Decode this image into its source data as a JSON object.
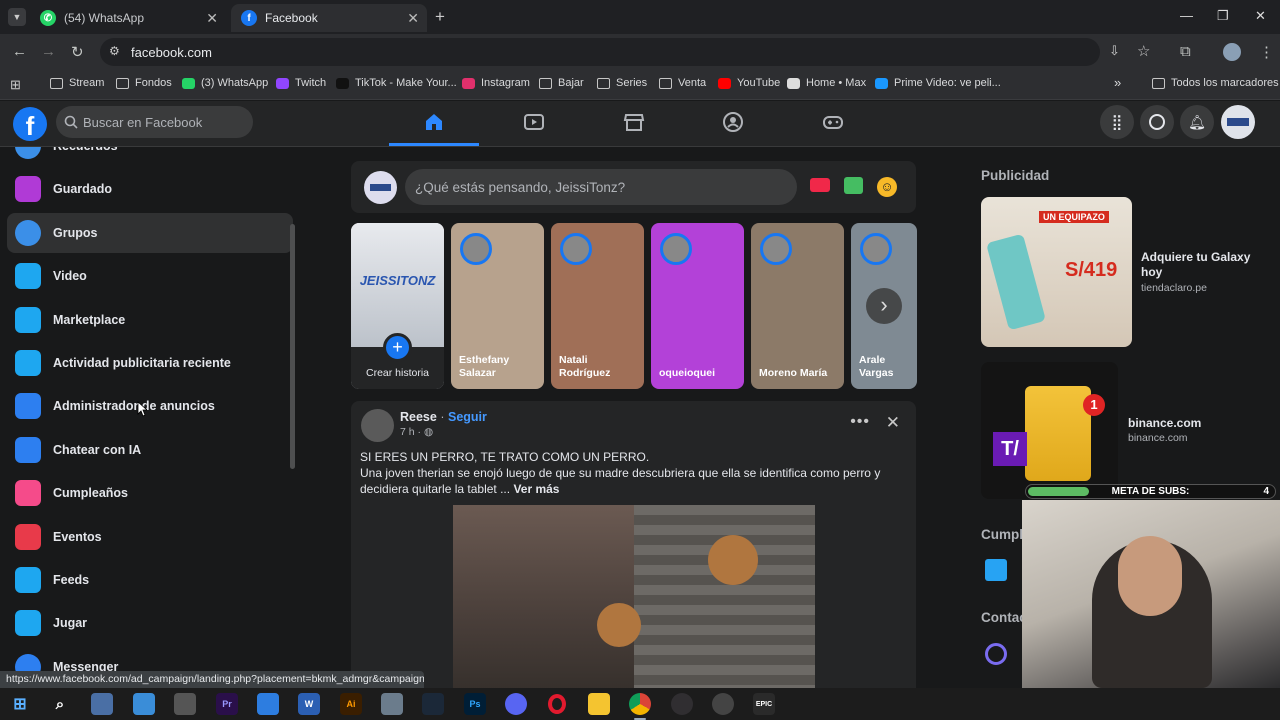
{
  "browser": {
    "tabs": [
      {
        "title": "(54) WhatsApp",
        "active": false
      },
      {
        "title": "Facebook",
        "active": true
      }
    ],
    "new_tab": "+",
    "url": "facebook.com",
    "bookmarks": [
      {
        "label": "Stream",
        "icon": "folder-icon"
      },
      {
        "label": "Fondos",
        "icon": "folder-icon"
      },
      {
        "label": "(3) WhatsApp",
        "icon": "whatsapp-icon"
      },
      {
        "label": "Twitch",
        "icon": "twitch-icon"
      },
      {
        "label": "TikTok - Make Your...",
        "icon": "tiktok-icon"
      },
      {
        "label": "Instagram",
        "icon": "instagram-icon"
      },
      {
        "label": "Bajar",
        "icon": "folder-icon"
      },
      {
        "label": "Series",
        "icon": "folder-icon"
      },
      {
        "label": "Venta",
        "icon": "folder-icon"
      },
      {
        "label": "YouTube",
        "icon": "youtube-icon"
      },
      {
        "label": "Home • Max",
        "icon": "max-icon"
      },
      {
        "label": "Prime Video: ve peli...",
        "icon": "prime-video-icon"
      }
    ],
    "overflow": "»",
    "all_bookmarks": "Todos los marcadores",
    "status_url": "https://www.facebook.com/ad_campaign/landing.php?placement=bkmk_admgr&campaign_i..."
  },
  "fb": {
    "search_placeholder": "Buscar en Facebook",
    "sidebar": [
      {
        "label": "Recuerdos",
        "icon": "memories-icon",
        "color": "#3b8fe8"
      },
      {
        "label": "Guardado",
        "icon": "saved-icon",
        "color": "#b03ad6"
      },
      {
        "label": "Grupos",
        "icon": "groups-icon",
        "color": "#3b8fe8"
      },
      {
        "label": "Video",
        "icon": "video-icon",
        "color": "#1ea7f0"
      },
      {
        "label": "Marketplace",
        "icon": "marketplace-icon",
        "color": "#1ea7f0"
      },
      {
        "label": "Actividad publicitaria reciente",
        "icon": "ad-activity-icon",
        "color": "#1ea7f0"
      },
      {
        "label": "Administrador de anuncios",
        "icon": "ads-manager-icon",
        "color": "#2d7ff0"
      },
      {
        "label": "Chatear con IA",
        "icon": "ai-chat-icon",
        "color": "#2d7ff0"
      },
      {
        "label": "Cumpleaños",
        "icon": "birthday-icon",
        "color": "#f54b8a"
      },
      {
        "label": "Eventos",
        "icon": "events-icon",
        "color": "#e83a4a"
      },
      {
        "label": "Feeds",
        "icon": "feeds-icon",
        "color": "#1ea7f0"
      },
      {
        "label": "Jugar",
        "icon": "play-icon",
        "color": "#1ea7f0"
      },
      {
        "label": "Messenger",
        "icon": "messenger-icon",
        "color": "#2d7ff0"
      }
    ],
    "composer_placeholder": "¿Qué estás pensando, JeissiTonz?",
    "stories": [
      {
        "name": "Crear historia",
        "own": true,
        "bg": "#cfd3d9"
      },
      {
        "name": "Esthefany Salazar",
        "bg": "#b7a28d"
      },
      {
        "name": "Natali Rodríguez",
        "bg": "#a06f57"
      },
      {
        "name": "oqueioquei",
        "bg": "#b341d8"
      },
      {
        "name": "Moreno María",
        "bg": "#8c7a68"
      },
      {
        "name": "Arale Vargas",
        "bg": "#7f8a93"
      }
    ],
    "story_logo": "JEISSITONZ",
    "post": {
      "author": "Reese",
      "follow": "Seguir",
      "time": "7 h",
      "separator": "·",
      "headline": "SI ERES UN PERRO, TE TRATO COMO UN PERRO.",
      "body": "Una joven therian se enojó luego de que su madre descubriera que ella se identifica como perro y decidiera quitarle la tablet ...",
      "more": "Ver más"
    },
    "right": {
      "ads_title": "Publicidad",
      "ads": [
        {
          "title": "Adquiere tu Galaxy hoy",
          "domain": "tiendaclaro.pe",
          "price": "S/419",
          "badge": "UN EQUIPAZO"
        },
        {
          "title": "binance.com",
          "domain": "binance.com",
          "badge": "1"
        }
      ],
      "birthdays_title": "Cumple",
      "contacts_title": "Contac"
    }
  },
  "overlay": {
    "subs_label": "META DE SUBS:",
    "subs_count": "4",
    "subs_progress": 0.25
  },
  "colors": {
    "fb_blue": "#1877f2",
    "link_blue": "#4599ff",
    "bg": "#18191a",
    "card": "#242526"
  }
}
